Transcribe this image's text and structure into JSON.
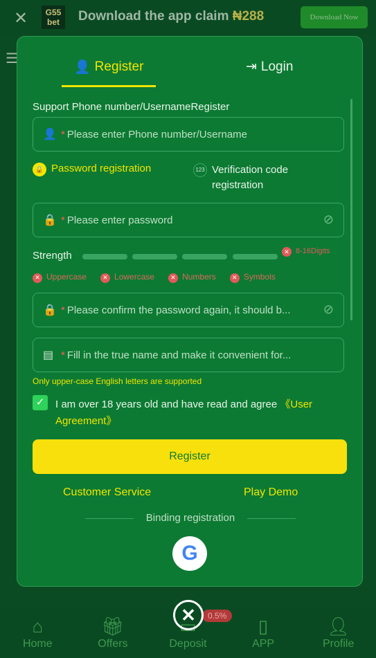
{
  "banner": {
    "logo": "G55 bet",
    "title": "Download the app claim",
    "amount": "₦288",
    "download": "Download Now"
  },
  "tabs": {
    "register": "Register",
    "login": "Login"
  },
  "form": {
    "label": "Support Phone number/UsernameRegister",
    "username_placeholder": "Please enter Phone number/Username",
    "password_registration": "Password registration",
    "verification_registration": "Verification code registration",
    "verification_icon": "123",
    "password_placeholder": "Please enter password",
    "strength_label": "Strength",
    "digits_rule": "8-16Digits",
    "rules": [
      "Uppercase",
      "Lowercase",
      "Numbers",
      "Symbols"
    ],
    "confirm_placeholder": "Please confirm the password again, it should b...",
    "name_placeholder": "Fill in the true name and make it convenient for...",
    "name_note": "Only upper-case English letters are supported",
    "agree_text": "I am over 18 years old and have read and agree ",
    "agree_link": "《User Agreement》",
    "agree_checked": true,
    "register_button": "Register",
    "customer_service": "Customer Service",
    "play_demo": "Play Demo",
    "binding": "Binding registration"
  },
  "nav": {
    "items": [
      {
        "label": "Home",
        "icon": "home-icon"
      },
      {
        "label": "Offers",
        "icon": "gift-icon"
      },
      {
        "label": "Deposit",
        "icon": "wallet-icon"
      },
      {
        "label": "APP",
        "icon": "phone-icon"
      },
      {
        "label": "Profile",
        "icon": "user-icon"
      }
    ],
    "deposit_badge": "0.5%"
  },
  "colors": {
    "accent": "#f2e600",
    "modal": "#0c7a33",
    "background": "#0b4b23",
    "error": "#e05a5a"
  }
}
